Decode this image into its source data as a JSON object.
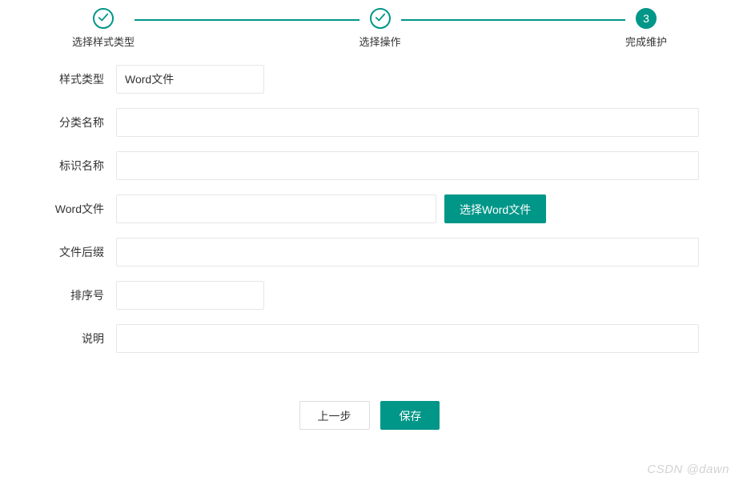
{
  "steps": {
    "items": [
      {
        "label": "选择样式类型",
        "done": true
      },
      {
        "label": "选择操作",
        "done": true
      },
      {
        "label": "完成维护",
        "number": "3",
        "active": true
      }
    ]
  },
  "form": {
    "style_type_label": "样式类型",
    "style_type_value": "Word文件",
    "category_name_label": "分类名称",
    "category_name_value": "",
    "identity_name_label": "标识名称",
    "identity_name_value": "",
    "word_file_label": "Word文件",
    "word_file_value": "",
    "choose_file_btn": "选择Word文件",
    "file_suffix_label": "文件后缀",
    "file_suffix_value": "",
    "sort_no_label": "排序号",
    "sort_no_value": "",
    "description_label": "说明",
    "description_value": ""
  },
  "actions": {
    "prev_label": "上一步",
    "save_label": "保存"
  },
  "watermark": "CSDN @dawn",
  "colors": {
    "primary": "#009688"
  }
}
